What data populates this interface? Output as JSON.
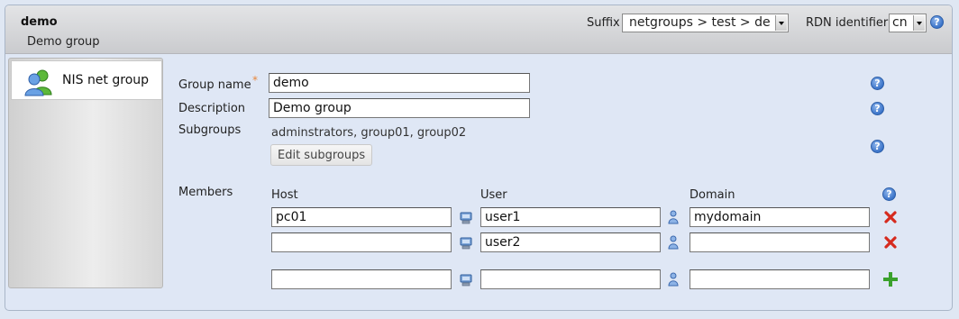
{
  "header": {
    "title": "demo",
    "subtitle": "Demo group",
    "suffix_label": "Suffix",
    "suffix_value": "netgroups > test > de",
    "rdn_label": "RDN identifier",
    "rdn_value": "cn"
  },
  "sidebar": {
    "tabs": [
      {
        "label": "NIS net group",
        "icon": "user-group-icon"
      }
    ]
  },
  "form": {
    "group_name_label": "Group name",
    "required_mark": "*",
    "group_name_value": "demo",
    "description_label": "Description",
    "description_value": "Demo group",
    "subgroups_label": "Subgroups",
    "subgroups_value": "adminstrators, group01, group02",
    "edit_subgroups_button": "Edit subgroups",
    "members_label": "Members",
    "members": {
      "columns": [
        "Host",
        "User",
        "Domain"
      ],
      "rows": [
        {
          "host": "pc01",
          "user": "user1",
          "domain": "mydomain"
        },
        {
          "host": "",
          "user": "user2",
          "domain": ""
        }
      ],
      "new_row": {
        "host": "",
        "user": "",
        "domain": ""
      }
    }
  },
  "icons": {
    "help": "help-icon",
    "host": "computer-icon",
    "user": "person-icon",
    "delete": "delete-icon",
    "add": "add-icon"
  },
  "colors": {
    "help_blue": "#3b74c9",
    "delete_red": "#d62a1e",
    "add_green": "#3aa12c",
    "required_orange": "#e8873c"
  }
}
